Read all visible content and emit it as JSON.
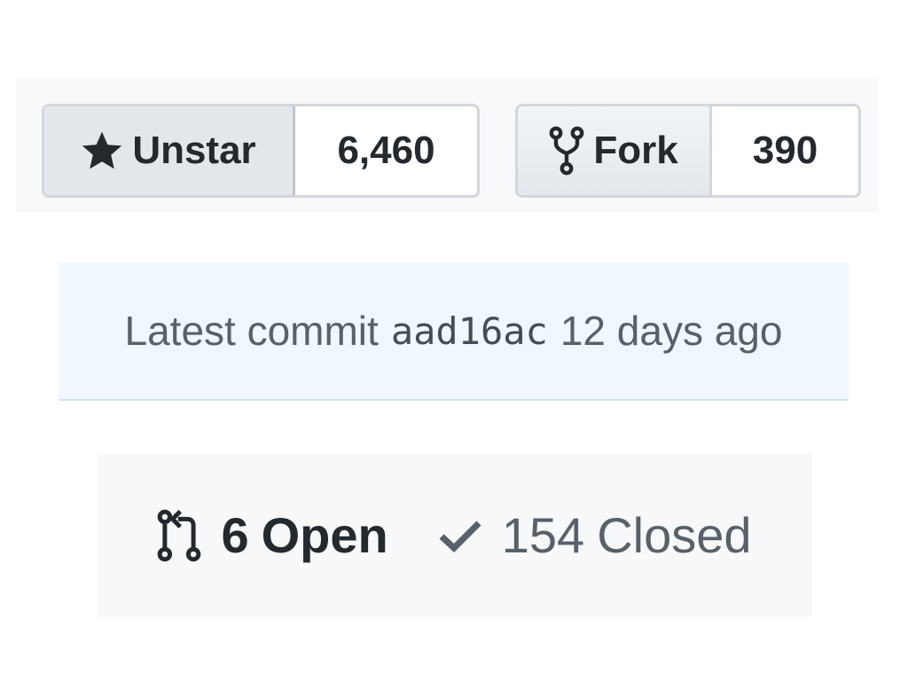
{
  "star": {
    "label": "Unstar",
    "count": "6,460",
    "icon": "star-icon"
  },
  "fork": {
    "label": "Fork",
    "count": "390",
    "icon": "repo-forked-icon"
  },
  "commit": {
    "label": "Latest commit",
    "sha": "aad16ac",
    "age": "12 days ago"
  },
  "states": {
    "open": {
      "count": "6",
      "label": "Open",
      "icon": "git-pull-request-icon"
    },
    "closed": {
      "count": "154",
      "label": "Closed",
      "icon": "check-icon"
    }
  },
  "colors": {
    "text": "#24292e",
    "muted": "#586069",
    "commit_bg": "#f0f7fd",
    "states_bg": "#f6f8fa",
    "button_border": "#d3d7dc"
  }
}
